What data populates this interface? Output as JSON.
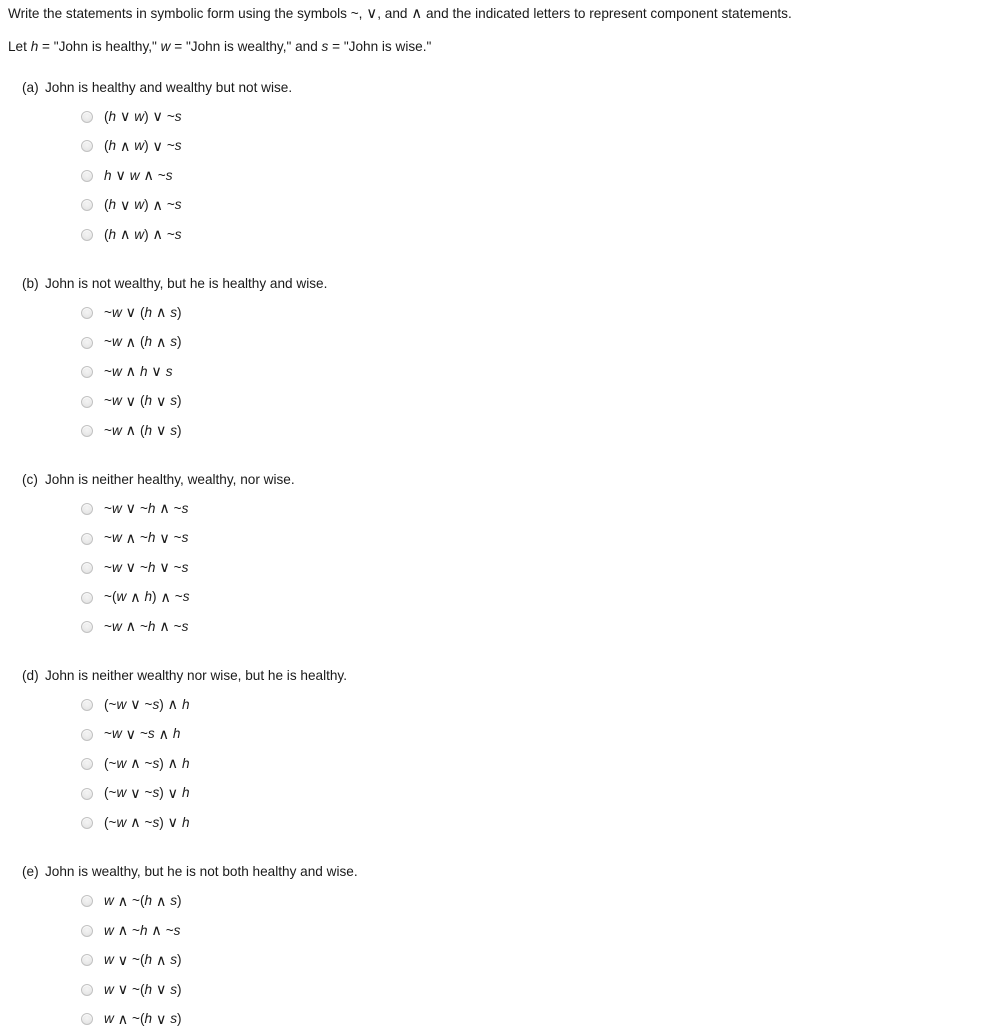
{
  "intro": {
    "prompt": "Write the statements in symbolic form using the symbols ~, ∨, and ∧ and the indicated letters to represent component statements.",
    "legend": "Let h = \"John is healthy,\" w = \"John is wealthy,\" and s = \"John is wise.\""
  },
  "symbols": {
    "not": "~",
    "or": "∨",
    "and": "∧"
  },
  "letters": {
    "h": "h",
    "w": "w",
    "s": "s"
  },
  "colors": {
    "text": "#1a1a1a",
    "background": "#ffffff",
    "radio_fill": "#e9e9e9",
    "radio_border": "#c2c2c2"
  },
  "questions": [
    {
      "label": "(a)",
      "text": "John is healthy and wealthy but not wise.",
      "options": [
        "(h ∨ w) ∨ ~s",
        "(h ∧ w) ∨ ~s",
        "h ∨ w ∧ ~s",
        "(h ∨ w) ∧ ~s",
        "(h ∧ w) ∧ ~s"
      ]
    },
    {
      "label": "(b)",
      "text": "John is not wealthy, but he is healthy and wise.",
      "options": [
        "~w ∨ (h ∧ s)",
        "~w ∧ (h ∧ s)",
        "~w ∧ h ∨ s",
        "~w ∨ (h ∨ s)",
        "~w ∧ (h ∨ s)"
      ]
    },
    {
      "label": "(c)",
      "text": "John is neither healthy, wealthy, nor wise.",
      "options": [
        "~w ∨ ~h ∧ ~s",
        "~w ∧ ~h ∨ ~s",
        "~w ∨ ~h ∨ ~s",
        "~(w ∧ h) ∧ ~s",
        "~w ∧ ~h ∧ ~s"
      ]
    },
    {
      "label": "(d)",
      "text": "John is neither wealthy nor wise, but he is healthy.",
      "options": [
        "(~w ∨ ~s) ∧ h",
        "~w ∨ ~s ∧ h",
        "(~w ∧ ~s) ∧ h",
        "(~w ∨ ~s) ∨ h",
        "(~w ∧ ~s) ∨ h"
      ]
    },
    {
      "label": "(e)",
      "text": "John is wealthy, but he is not both healthy and wise.",
      "options": [
        "w ∧ ~(h ∧ s)",
        "w ∧ ~h ∧ ~s",
        "w ∨ ~(h ∧ s)",
        "w ∨ ~(h ∨ s)",
        "w ∧ ~(h ∨ s)"
      ]
    }
  ]
}
